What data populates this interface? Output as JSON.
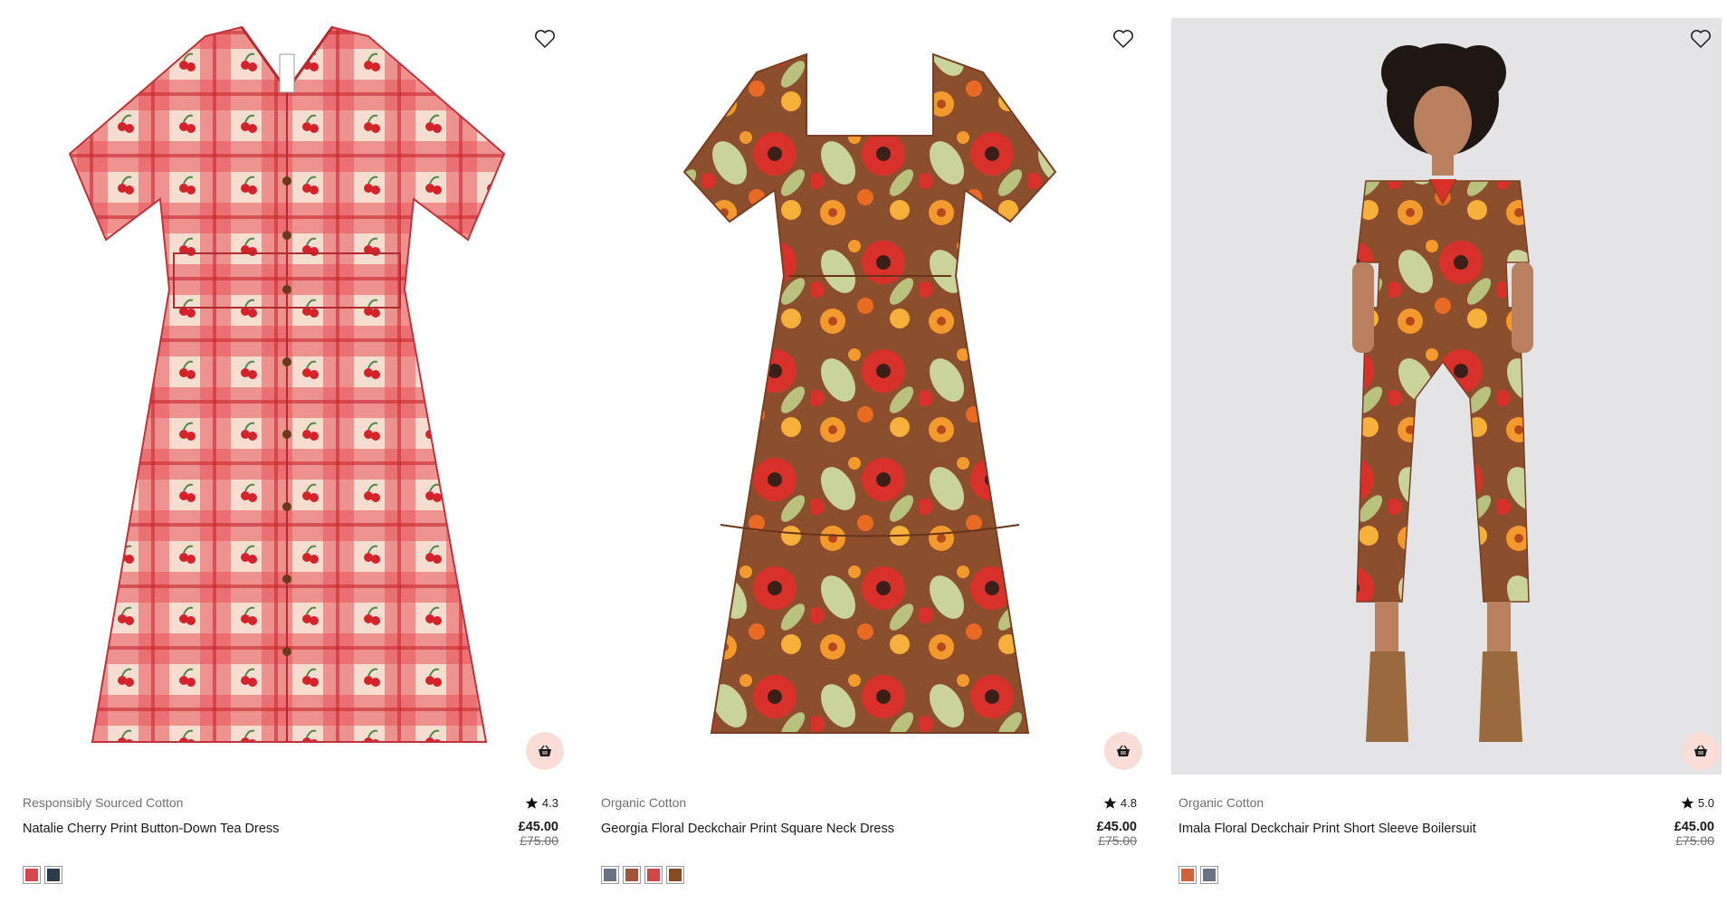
{
  "products": [
    {
      "tag": "Responsibly Sourced Cotton",
      "rating": "4.3",
      "name": "Natalie Cherry Print Button-Down Tea Dress",
      "price": "£45.00",
      "was_price": "£75.00",
      "image_alt": "Red and cream gingham cherry print button-down tea dress",
      "swatches": [
        {
          "name": "cherry-gingham",
          "color": "#d8464f"
        },
        {
          "name": "dark-floral",
          "color": "#2b3c4a"
        }
      ]
    },
    {
      "tag": "Organic Cotton",
      "rating": "4.8",
      "name": "Georgia Floral Deckchair Print Square Neck Dress",
      "price": "£45.00",
      "was_price": "£75.00",
      "image_alt": "Brown, red and orange retro floral square neck dress",
      "swatches": [
        {
          "name": "navy-check",
          "color": "#6b7284"
        },
        {
          "name": "brown-floral",
          "color": "#a0553a"
        },
        {
          "name": "red-floral",
          "color": "#d0474a"
        },
        {
          "name": "rust-floral",
          "color": "#8a4a1f"
        }
      ]
    },
    {
      "tag": "Organic Cotton",
      "rating": "5.0",
      "name": "Imala Floral Deckchair Print Short Sleeve Boilersuit",
      "price": "£45.00",
      "was_price": "£75.00",
      "image_alt": "Model wearing retro floral short sleeve boilersuit with brown boots",
      "swatches": [
        {
          "name": "orange-floral",
          "color": "#d0613a"
        },
        {
          "name": "navy-check",
          "color": "#6b7284"
        }
      ]
    }
  ],
  "colors": {
    "basket_bg": "#f9ddd6",
    "page_bg": "#ffffff",
    "model_bg": "#e4e4e6"
  },
  "icons": {
    "wishlist": "heart-outline-icon",
    "add_to_bag": "basket-icon",
    "rating": "star-icon"
  }
}
